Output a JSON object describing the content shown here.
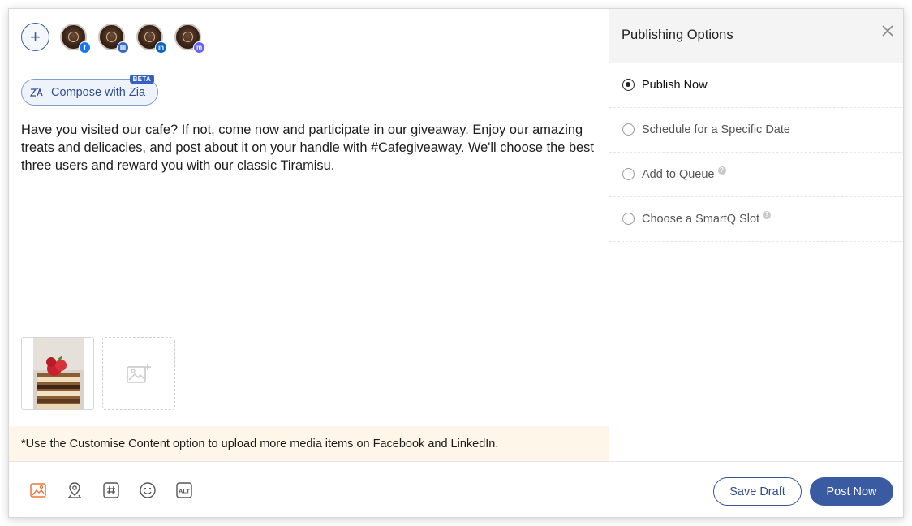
{
  "accounts": [
    {
      "name": "avatar-facebook",
      "network": "facebook",
      "badge": "f"
    },
    {
      "name": "avatar-business",
      "network": "google-business",
      "badge": "▦"
    },
    {
      "name": "avatar-linkedin",
      "network": "linkedin",
      "badge": "in"
    },
    {
      "name": "avatar-mastodon",
      "network": "mastodon",
      "badge": "m"
    }
  ],
  "composer": {
    "add_account_icon": "plus-icon",
    "zia_button_label": "Compose with Zia",
    "zia_badge": "BETA",
    "post_text": "Have you visited our cafe? If not, come now and participate in our giveaway. Enjoy our amazing treats and delicacies, and post about it on your handle with #Cafegiveaway. We'll choose the best three users and reward you with our classic Tiramisu.",
    "notice": "*Use the Customise Content option to upload more media items on Facebook and LinkedIn."
  },
  "panel": {
    "title": "Publishing Options",
    "options": [
      {
        "label": "Publish Now",
        "selected": true,
        "help": false
      },
      {
        "label": "Schedule for a Specific Date",
        "selected": false,
        "help": false
      },
      {
        "label": "Add to Queue",
        "selected": false,
        "help": true
      },
      {
        "label": "Choose a SmartQ Slot",
        "selected": false,
        "help": true
      }
    ]
  },
  "toolbar": {
    "tools": [
      "image-icon",
      "location-icon",
      "hashtag-icon",
      "emoji-icon",
      "alt-text-icon"
    ],
    "save_draft_label": "Save Draft",
    "post_now_label": "Post Now"
  },
  "colors": {
    "accent": "#3a5aa2",
    "notice_bg": "#fdf6e9",
    "image_tool": "#e8773a"
  }
}
